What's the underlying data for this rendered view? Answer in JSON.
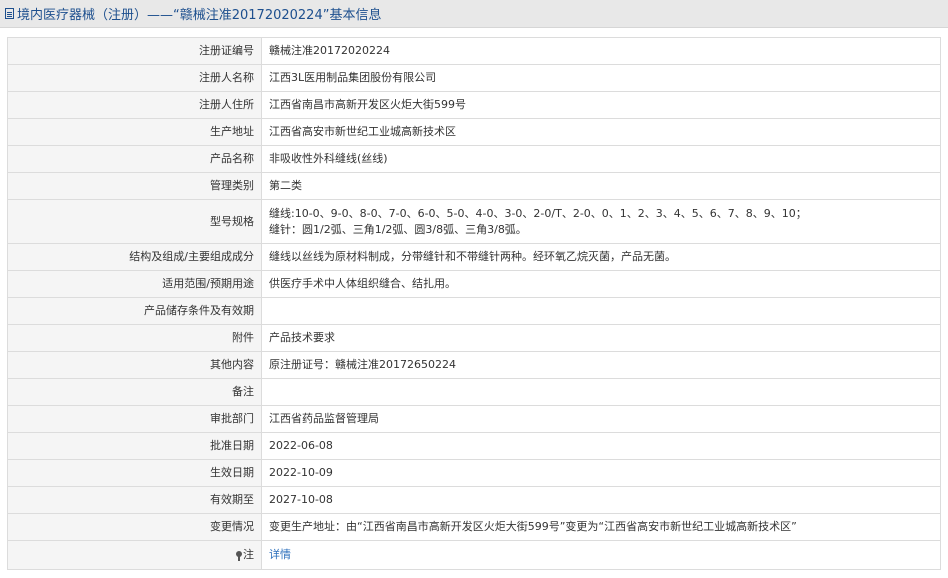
{
  "page": {
    "title": "境内医疗器械（注册）——“赣械注准20172020224”基本信息"
  },
  "rows": [
    {
      "label": "注册证编号",
      "value": "赣械注准20172020224"
    },
    {
      "label": "注册人名称",
      "value": "江西3L医用制品集团股份有限公司"
    },
    {
      "label": "注册人住所",
      "value": "江西省南昌市高新开发区火炬大街599号"
    },
    {
      "label": "生产地址",
      "value": "江西省高安市新世纪工业城高新技术区"
    },
    {
      "label": "产品名称",
      "value": "非吸收性外科缝线(丝线)"
    },
    {
      "label": "管理类别",
      "value": "第二类"
    },
    {
      "label": "型号规格",
      "value": "缝线:10-0、9-0、8-0、7-0、6-0、5-0、4-0、3-0、2-0/T、2-0、0、1、2、3、4、5、6、7、8、9、10；",
      "value2": "缝针：圆1/2弧、三角1/2弧、圆3/8弧、三角3/8弧。"
    },
    {
      "label": "结构及组成/主要组成成分",
      "value": "缝线以丝线为原材料制成，分带缝针和不带缝针两种。经环氧乙烷灭菌，产品无菌。"
    },
    {
      "label": "适用范围/预期用途",
      "value": "供医疗手术中人体组织缝合、结扎用。"
    },
    {
      "label": "产品储存条件及有效期",
      "value": ""
    },
    {
      "label": "附件",
      "value": "产品技术要求"
    },
    {
      "label": "其他内容",
      "value": "原注册证号：赣械注准20172650224"
    },
    {
      "label": "备注",
      "value": ""
    },
    {
      "label": "审批部门",
      "value": "江西省药品监督管理局"
    },
    {
      "label": "批准日期",
      "value": "2022-06-08"
    },
    {
      "label": "生效日期",
      "value": "2022-10-09"
    },
    {
      "label": "有效期至",
      "value": "2027-10-08"
    },
    {
      "label": "变更情况",
      "value": "变更生产地址：由“江西省南昌市高新开发区火炬大街599号”变更为“江西省高安市新世纪工业城高新技术区”"
    },
    {
      "label": "注",
      "value": "详情"
    }
  ]
}
